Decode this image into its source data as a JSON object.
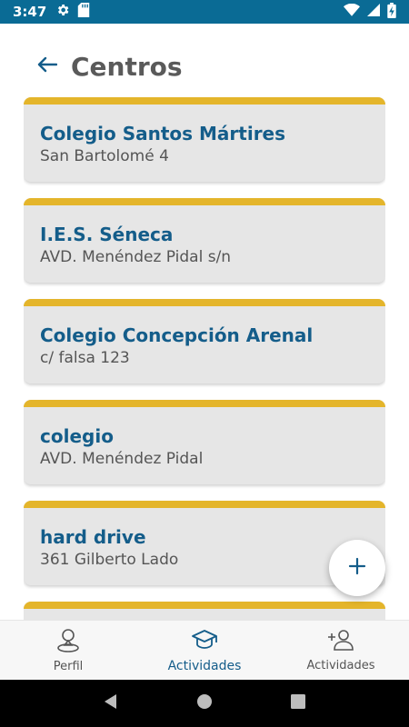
{
  "status_bar": {
    "time": "3:47"
  },
  "header": {
    "title": "Centros"
  },
  "centers": [
    {
      "name": "Colegio Santos Mártires",
      "address": "San Bartolomé 4"
    },
    {
      "name": "I.E.S. Séneca",
      "address": "AVD. Menéndez Pidal s/n"
    },
    {
      "name": "Colegio Concepción Arenal",
      "address": "c/ falsa 123"
    },
    {
      "name": "colegio",
      "address": "AVD. Menéndez Pidal"
    },
    {
      "name": "hard drive",
      "address": "361 Gilberto Lado"
    },
    {
      "name": "",
      "address": ""
    }
  ],
  "bottom_nav": {
    "items": [
      {
        "label": "Perfil",
        "icon": "person-pin-icon"
      },
      {
        "label": "Actividades",
        "icon": "graduation-cap-icon"
      },
      {
        "label": "Actividades",
        "icon": "add-person-icon"
      }
    ]
  },
  "colors": {
    "primary": "#145d8a",
    "accent": "#e4b52b",
    "status_bar": "#0a6b95",
    "card_bg": "#e6e6e6"
  }
}
